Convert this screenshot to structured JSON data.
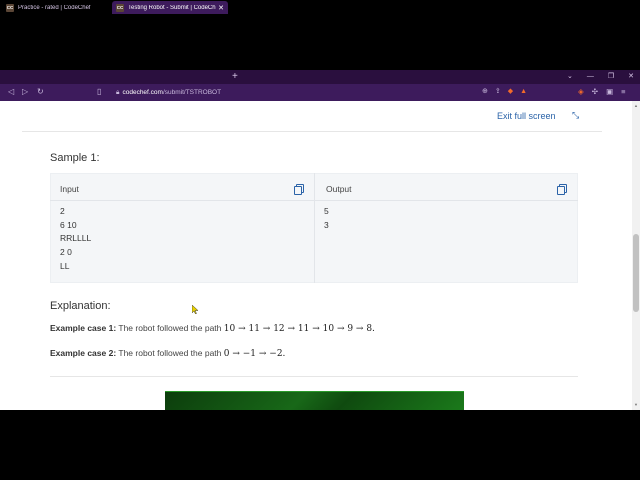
{
  "browser": {
    "tabs": [
      {
        "label": "Practice - rated | CodeChef",
        "favicon": "CC"
      },
      {
        "label": "Testing Robot - Submit | CodeCh",
        "favicon": "CC"
      }
    ],
    "url_host": "codechef.com",
    "url_path": "/submit/TSTROBOT"
  },
  "page": {
    "exit_fullscreen": "Exit full screen",
    "sample_heading": "Sample 1:",
    "input_label": "Input",
    "output_label": "Output",
    "input_lines": [
      "2",
      "6 10",
      "RRLLLL",
      "2 0",
      "LL"
    ],
    "output_lines": [
      "5",
      "3"
    ],
    "explanation_heading": "Explanation:",
    "cases": [
      {
        "label": "Example case 1:",
        "text": "The robot followed the path",
        "math": "10 → 11 → 12 → 11 → 10 → 9 → 8."
      },
      {
        "label": "Example case 2:",
        "text": "The robot followed the path",
        "math": "0 → −1 → −2."
      }
    ]
  },
  "colors": {
    "accent": "#2b63a8",
    "tab_bar": "#2a0f3e",
    "url_bar": "#3d1b5c"
  }
}
